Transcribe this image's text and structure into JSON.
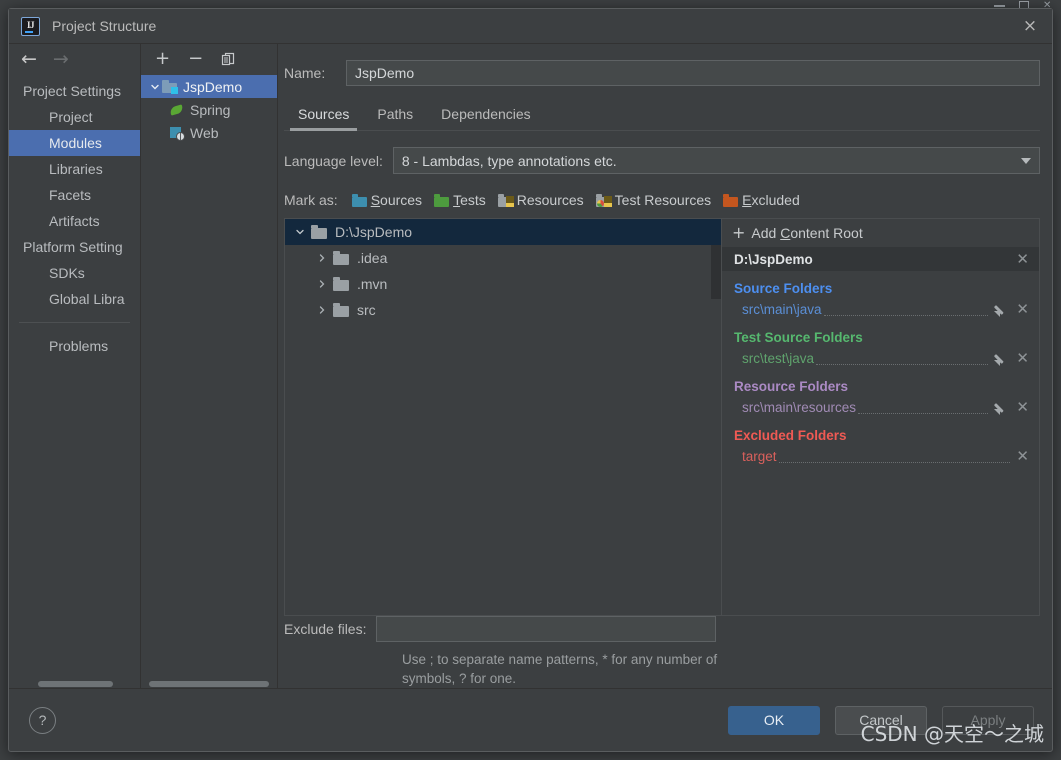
{
  "window": {
    "title": "Project Structure",
    "app_icon": "intellij-idea-icon",
    "close_label": "×"
  },
  "sidebar": {
    "back_icon": "←",
    "forward_icon": "→",
    "items": [
      {
        "label": "Project Settings",
        "type": "group",
        "selected": false
      },
      {
        "label": "Project",
        "type": "child",
        "selected": false
      },
      {
        "label": "Modules",
        "type": "child",
        "selected": true
      },
      {
        "label": "Libraries",
        "type": "child",
        "selected": false
      },
      {
        "label": "Facets",
        "type": "child",
        "selected": false
      },
      {
        "label": "Artifacts",
        "type": "child",
        "selected": false
      },
      {
        "label": "Platform Setting",
        "type": "group",
        "selected": false
      },
      {
        "label": "SDKs",
        "type": "child",
        "selected": false
      },
      {
        "label": "Global Libra",
        "type": "child",
        "selected": false
      }
    ],
    "problems_label": "Problems"
  },
  "module_panel": {
    "toolbar": {
      "add_label": "+",
      "remove_label": "−",
      "copy_label": "copy-icon"
    },
    "tree": [
      {
        "label": "JspDemo",
        "icon": "module-folder-icon",
        "level": 0,
        "expanded": true,
        "selected": true
      },
      {
        "label": "Spring",
        "icon": "spring-leaf-icon",
        "level": 1,
        "expanded": false,
        "selected": false
      },
      {
        "label": "Web",
        "icon": "web-globe-icon",
        "level": 1,
        "expanded": false,
        "selected": false
      }
    ]
  },
  "main": {
    "name_label": "Name:",
    "name_value": "JspDemo",
    "tabs": [
      {
        "label": "Sources",
        "active": true
      },
      {
        "label": "Paths",
        "active": false
      },
      {
        "label": "Dependencies",
        "active": false
      }
    ],
    "language_level_label": "Language level:",
    "language_level_value": "8 - Lambdas, type annotations etc.",
    "mark_as": {
      "label": "Mark as:",
      "options": [
        {
          "label": "Sources",
          "mnemonic": "S",
          "rest": "ources",
          "icon": "sources-folder-icon",
          "color": "#3d8faf"
        },
        {
          "label": "Tests",
          "mnemonic": "T",
          "rest": "ests",
          "icon": "tests-folder-icon",
          "color": "#4d9b3e"
        },
        {
          "label": "Resources",
          "mnemonic": "",
          "rest": "Resources",
          "icon": "resources-folder-icon",
          "color": "#9aa0a4"
        },
        {
          "label": "Test Resources",
          "mnemonic": "",
          "rest": "Test Resources",
          "icon": "test-resources-folder-icon",
          "color": "#9aa0a4"
        },
        {
          "label": "Excluded",
          "mnemonic": "E",
          "rest": "xcluded",
          "icon": "excluded-folder-icon",
          "color": "#c4561f"
        }
      ]
    },
    "file_tree": [
      {
        "label": "D:\\JspDemo",
        "level": 0,
        "expanded": true,
        "selected": true
      },
      {
        "label": ".idea",
        "level": 1,
        "expanded": false,
        "selected": false
      },
      {
        "label": ".mvn",
        "level": 1,
        "expanded": false,
        "selected": false
      },
      {
        "label": "src",
        "level": 1,
        "expanded": false,
        "selected": false
      }
    ],
    "exclude": {
      "label": "Exclude files:",
      "value": "",
      "hint": "Use ; to separate name patterns, * for any number of symbols, ? for one."
    }
  },
  "content_roots": {
    "add_button": {
      "plus": "+",
      "pre": "Add ",
      "mnemonic": "C",
      "post": "ontent Root"
    },
    "root_path": "D:\\JspDemo",
    "groups": [
      {
        "title": "Source Folders",
        "kind": "src",
        "color": "#4d8ff0",
        "entries": [
          {
            "path": "src\\main\\java",
            "has_edit": true,
            "has_remove": true
          }
        ]
      },
      {
        "title": "Test Source Folders",
        "kind": "test",
        "color": "#56b86f",
        "entries": [
          {
            "path": "src\\test\\java",
            "has_edit": true,
            "has_remove": true
          }
        ]
      },
      {
        "title": "Resource Folders",
        "kind": "res",
        "color": "#ab8ac4",
        "entries": [
          {
            "path": "src\\main\\resources",
            "has_edit": true,
            "has_remove": true
          }
        ]
      },
      {
        "title": "Excluded Folders",
        "kind": "exc",
        "color": "#f05a54",
        "entries": [
          {
            "path": "target",
            "has_edit": false,
            "has_remove": true
          }
        ]
      }
    ]
  },
  "footer": {
    "help_label": "?",
    "ok_label": "OK",
    "cancel_label": "Cancel",
    "apply_label": "Apply"
  },
  "watermark": "CSDN @天空～之城"
}
